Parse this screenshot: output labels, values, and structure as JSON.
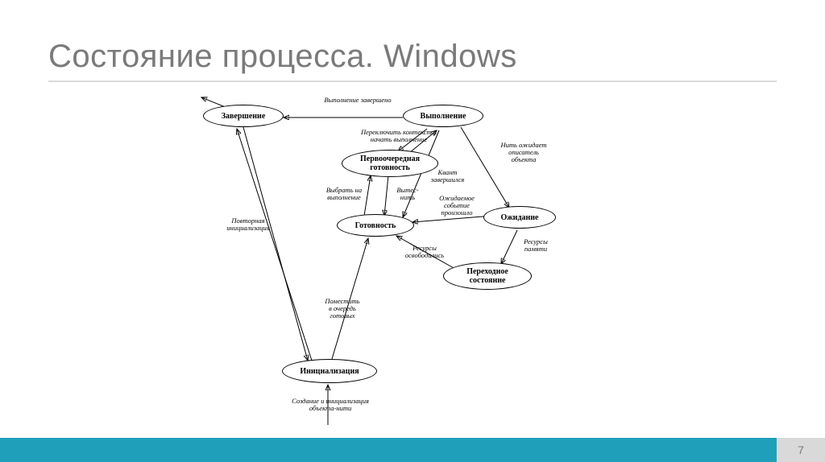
{
  "title": "Состояние процесса. Windows",
  "page_number": "7",
  "diagram": {
    "nodes": {
      "terminate": "Завершение",
      "running": "Выполнение",
      "top_ready": "Первоочередная готовность",
      "ready": "Готовность",
      "waiting": "Ожидание",
      "transition": "Переходное состояние",
      "init": "Инициализация"
    },
    "edges": {
      "exec_done": "Выполнение завершено",
      "switch_ctx": "Переключить контекст и начать выполнение",
      "reinit": "Повторная инициализация",
      "pick_exec": "Выбрать на выполнение",
      "preempt": "Вытес-\nнить",
      "quantum": "Квант\nзавершился",
      "thread_wait": "Нить ожидает\nописатель\nобъекта",
      "event_done": "Ожидаемое\nсобытие\nпроизошло",
      "res_freed": "Ресурсы\nосвободились",
      "res_mem": "Ресурсы\nпамяти",
      "enqueue": "Поместить\nв очередь\nготовых",
      "create": "Создание и инициализация\nобъекта-нити"
    }
  }
}
